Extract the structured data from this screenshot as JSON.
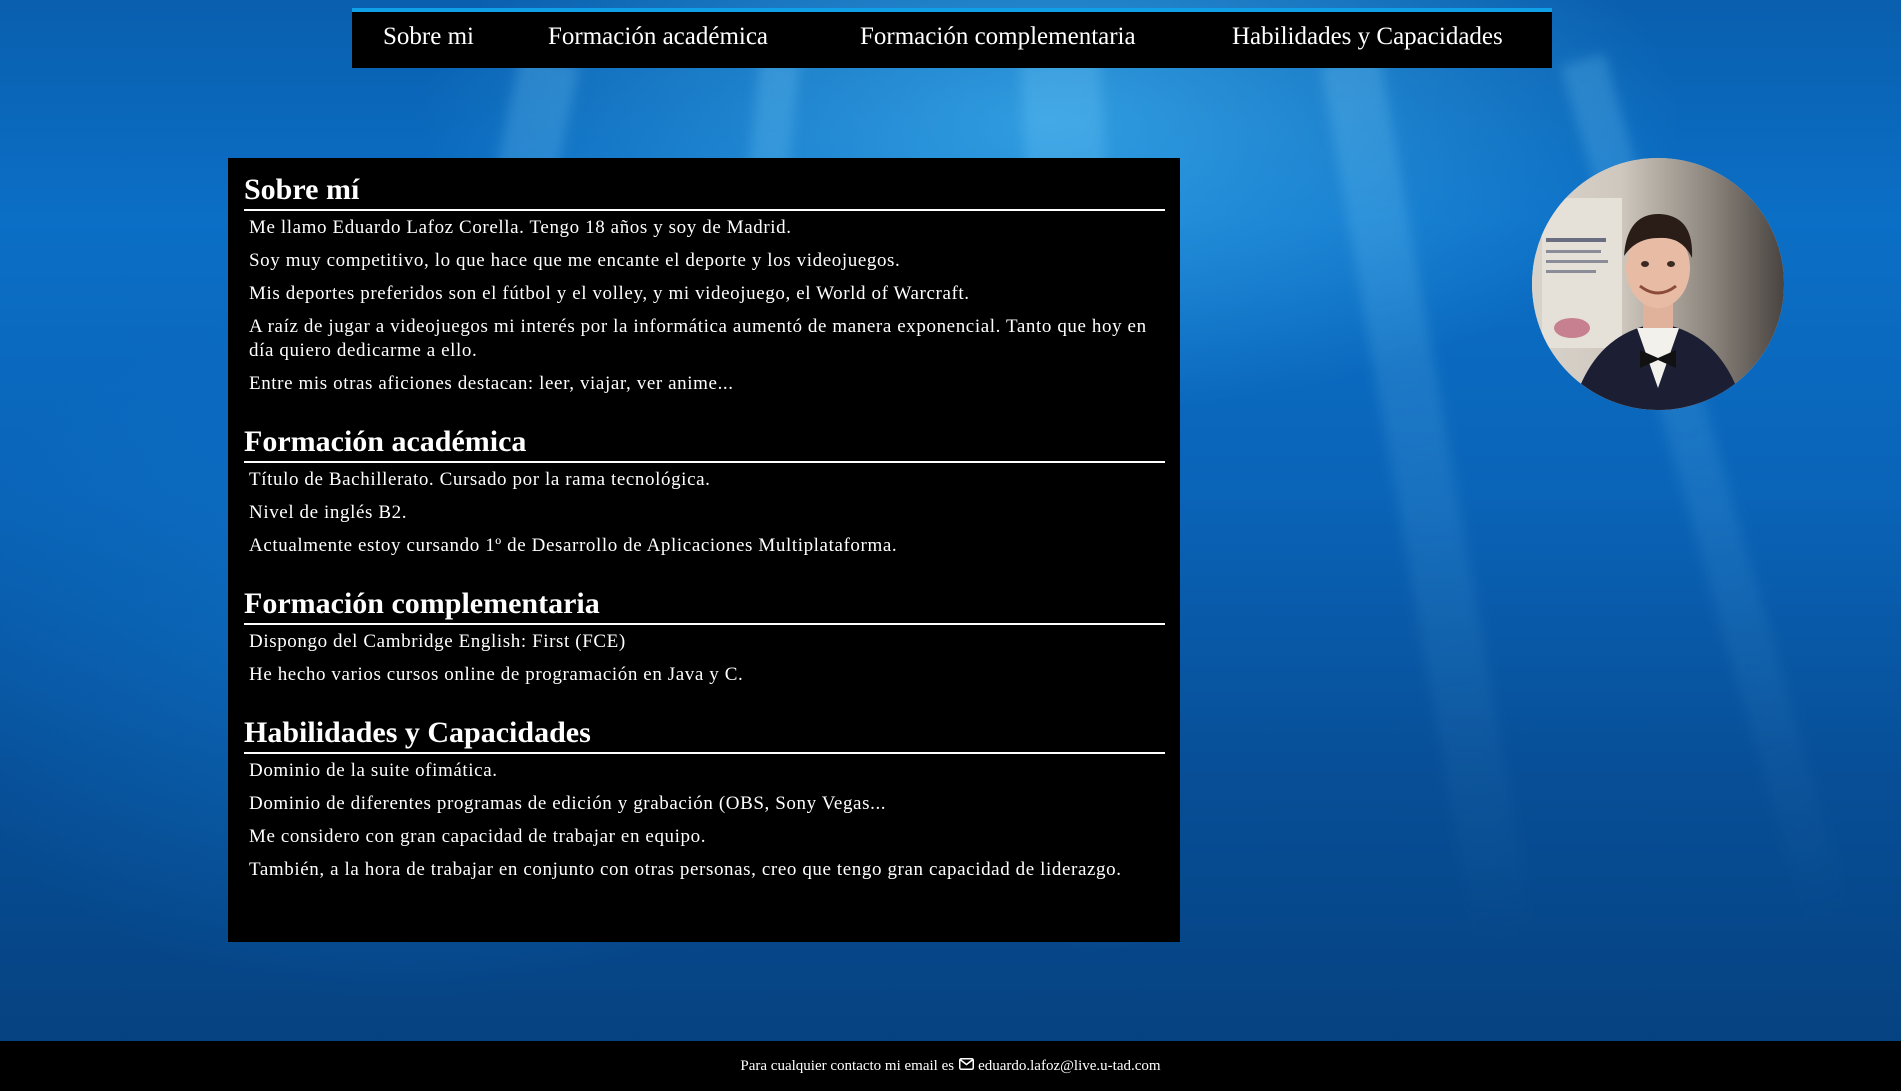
{
  "nav": {
    "items": [
      {
        "label": "Sobre mi"
      },
      {
        "label": "Formación académica"
      },
      {
        "label": "Formación complementaria"
      },
      {
        "label": "Habilidades y Capacidades"
      }
    ]
  },
  "sections": [
    {
      "title": "Sobre mí",
      "paragraphs": [
        "Me llamo Eduardo Lafoz Corella. Tengo 18 años y soy de Madrid.",
        "Soy muy competitivo, lo que hace que me encante el deporte y los videojuegos.",
        "Mis deportes preferidos son el fútbol y el volley, y mi videojuego, el World of Warcraft.",
        "A raíz de jugar a videojuegos mi interés por la informática aumentó de manera exponencial. Tanto que hoy en día quiero dedicarme a ello.",
        "Entre mis otras aficiones destacan: leer, viajar, ver anime..."
      ]
    },
    {
      "title": "Formación académica",
      "paragraphs": [
        "Título de Bachillerato. Cursado por la rama tecnológica.",
        "Nivel de inglés B2.",
        "Actualmente estoy cursando 1º de Desarrollo de Aplicaciones Multiplataforma."
      ]
    },
    {
      "title": "Formación complementaria",
      "paragraphs": [
        "Dispongo del Cambridge English: First (FCE)",
        "He hecho varios cursos online de programación en Java y C."
      ]
    },
    {
      "title": "Habilidades y Capacidades",
      "paragraphs": [
        "Dominio de la suite ofimática.",
        "Dominio de diferentes programas de edición y grabación (OBS, Sony Vegas...",
        "Me considero con gran capacidad de trabajar en equipo.",
        "También, a la hora de trabajar en conjunto con otras personas, creo que tengo gran capacidad de liderazgo."
      ]
    }
  ],
  "footer": {
    "text": "Para cualquier contacto mi email es",
    "icon": "envelope-icon",
    "email": "eduardo.lafoz@live.u-tad.com"
  },
  "colors": {
    "accent": "#0fa0e8",
    "panel": "#000000",
    "text": "#ffffff"
  }
}
